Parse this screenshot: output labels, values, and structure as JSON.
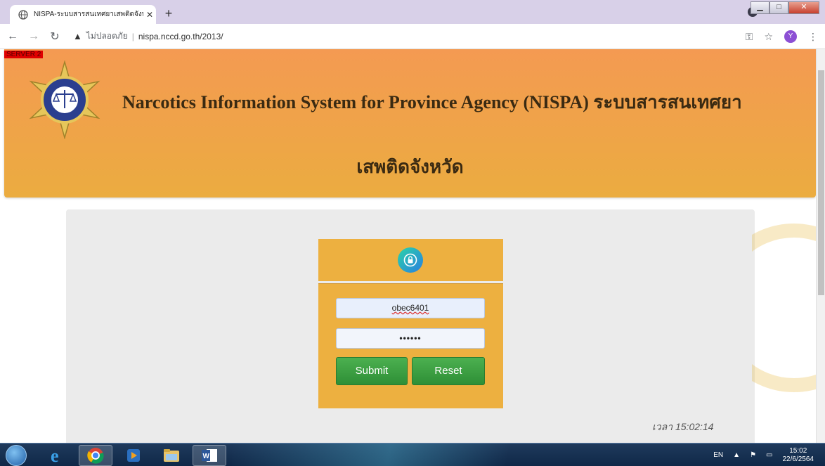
{
  "browser": {
    "tab_title": "NISPA-ระบบสารสนเทศยาเสพติดจังหวัด",
    "tab_close": "✕",
    "new_tab": "+",
    "security_label": "ไม่ปลอดภัย",
    "url": "nispa.nccd.go.th/2013/",
    "avatar_initial": "Y",
    "window_controls": {
      "minimize": "▁",
      "maximize": "□",
      "close": "✕"
    }
  },
  "page": {
    "server_badge": "SERVER 2",
    "header_title_line1": "Narcotics Information System for Province Agency (NISPA) ระบบสารสนเทศยา",
    "header_title_line2": "เสพติดจังหวัด",
    "login": {
      "username_value": "obec6401",
      "password_value": "••••••",
      "submit_label": "Submit",
      "reset_label": "Reset"
    },
    "time_label": "เวลา 15:02:14"
  },
  "taskbar": {
    "apps": [
      "internet-explorer",
      "chrome",
      "media-player",
      "file-explorer",
      "word"
    ],
    "language": "EN",
    "clock_time": "15:02",
    "clock_date": "22/6/2564"
  },
  "colors": {
    "header_top": "#f49a52",
    "header_bottom": "#ebac40",
    "login_box": "#edb040",
    "button_green": "#3a9e40",
    "panel_bg": "#ebebeb"
  }
}
